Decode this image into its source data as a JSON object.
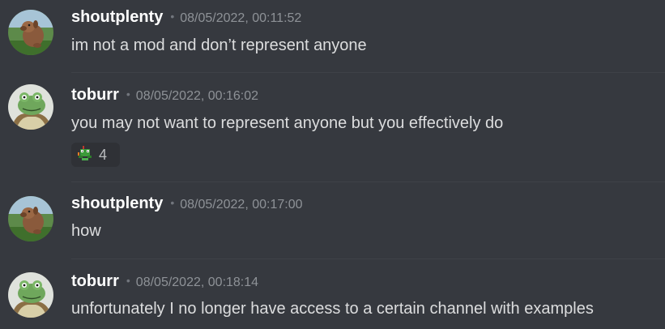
{
  "messages": [
    {
      "author": "shoutplenty",
      "separator": "•",
      "timestamp": "08/05/2022, 00:11:52",
      "content": "im not a mod and don’t represent anyone",
      "avatar_icon": "dog-plush-avatar-icon"
    },
    {
      "author": "toburr",
      "separator": "•",
      "timestamp": "08/05/2022, 00:16:02",
      "content": "you may not want to represent anyone but you effectively do",
      "avatar_icon": "frog-avatar-icon",
      "reaction": {
        "emoji_icon": "pixel-frog-emoji-icon",
        "count": "4"
      }
    },
    {
      "author": "shoutplenty",
      "separator": "•",
      "timestamp": "08/05/2022, 00:17:00",
      "content": "how",
      "avatar_icon": "dog-plush-avatar-icon"
    },
    {
      "author": "toburr",
      "separator": "•",
      "timestamp": "08/05/2022, 00:18:14",
      "content": "unfortunately I no longer have access to a certain channel with examples",
      "avatar_icon": "frog-avatar-icon"
    }
  ],
  "colors": {
    "background": "#36393f",
    "username": "#ffffff",
    "timestamp": "#8e9297",
    "content": "#dcddde",
    "reaction_bg": "#2f3136"
  }
}
